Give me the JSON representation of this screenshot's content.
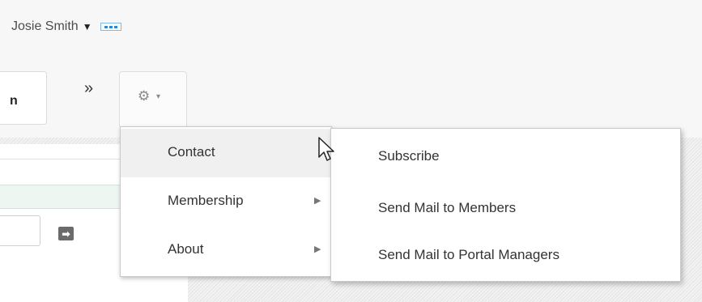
{
  "header": {
    "user_name": "Josie Smith",
    "user_caret": "▼",
    "more_icon": "dots-icon"
  },
  "toolbar": {
    "tab_partial_label": "n",
    "overflow_glyph": "»",
    "gear_icon": "gear-icon",
    "gear_caret": "▾"
  },
  "content": {
    "go_glyph": "➡"
  },
  "menu": {
    "items": [
      {
        "label": "Contact",
        "has_submenu": false,
        "active": true
      },
      {
        "label": "Membership",
        "has_submenu": true,
        "arrow": "▶"
      },
      {
        "label": "About",
        "has_submenu": true,
        "arrow": "▶"
      }
    ]
  },
  "submenu": {
    "items": [
      {
        "label": "Subscribe"
      },
      {
        "label": "Send Mail to Members"
      },
      {
        "label": "Send Mail to Portal Managers"
      }
    ]
  },
  "colors": {
    "accent": "#2b8ad8",
    "menu_hover": "#f0f0f0"
  }
}
